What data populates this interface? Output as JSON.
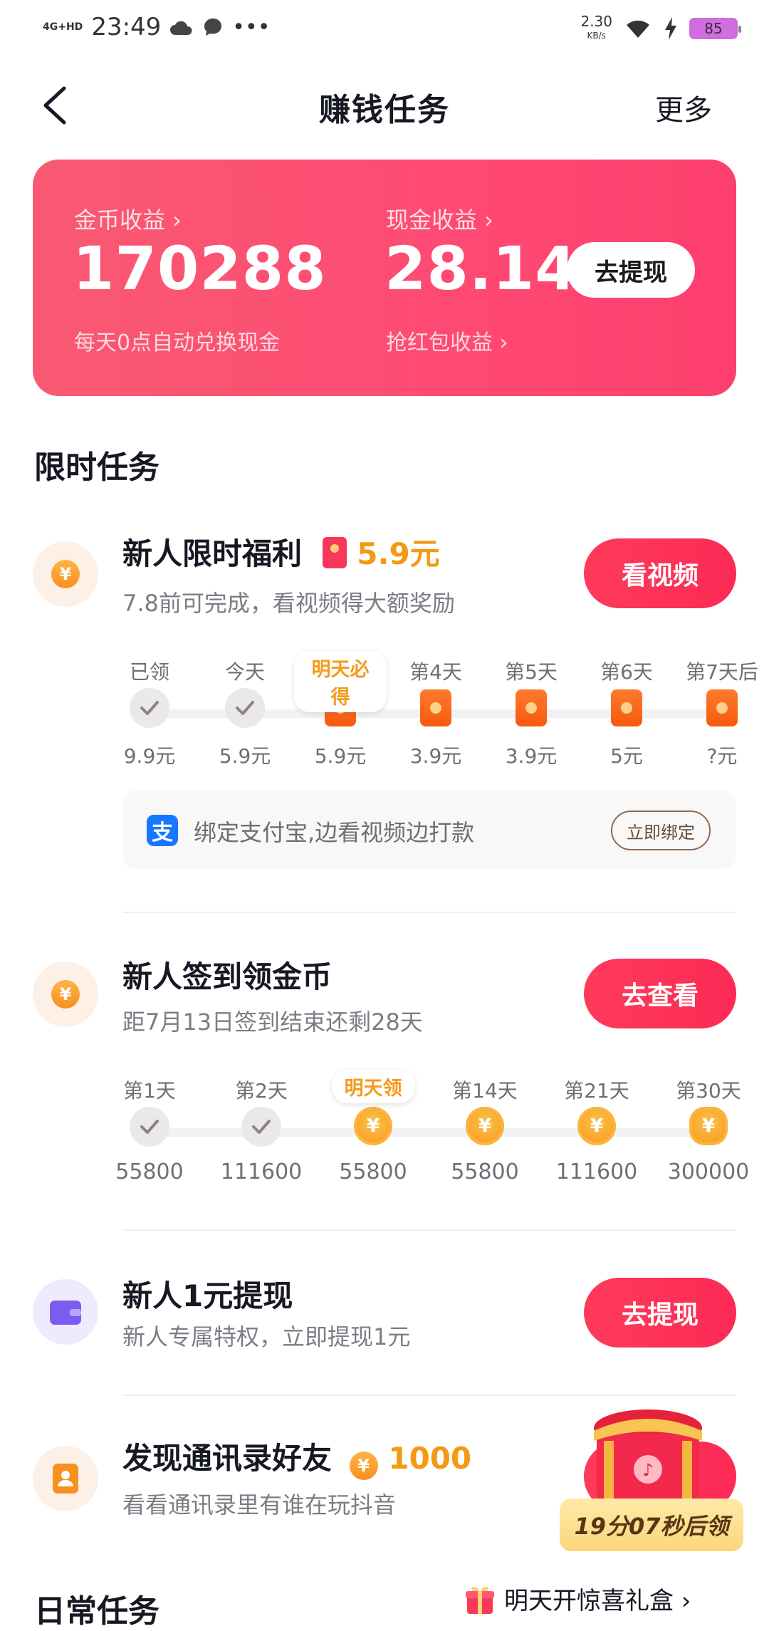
{
  "status_bar": {
    "time": "23:49",
    "network": "4G+HD",
    "speed_value": "2.30",
    "speed_unit": "KB/s",
    "battery": "85"
  },
  "nav": {
    "title": "赚钱任务",
    "more": "更多"
  },
  "earnings": {
    "coin_label": "金币收益 ›",
    "coin_value": "170288",
    "coin_note": "每天0点自动兑换现金",
    "cash_label": "现金收益 ›",
    "cash_value": "28.14",
    "cash_note": "抢红包收益 ›",
    "withdraw": "去提现"
  },
  "limited": {
    "section_title": "限时任务",
    "task1": {
      "title": "新人限时福利",
      "reward": "5.9元",
      "desc": "7.8前可完成，看视频得大额奖励",
      "button": "看视频",
      "steps": [
        {
          "day": "已领",
          "value": "9.9元"
        },
        {
          "day": "今天",
          "value": "5.9元"
        },
        {
          "day": "明天必得",
          "value": "5.9元"
        },
        {
          "day": "第4天",
          "value": "3.9元"
        },
        {
          "day": "第5天",
          "value": "3.9元"
        },
        {
          "day": "第6天",
          "value": "5元"
        },
        {
          "day": "第7天后",
          "value": "?元"
        }
      ],
      "bind_text": "绑定支付宝,边看视频边打款",
      "bind_button": "立即绑定"
    },
    "task2": {
      "title": "新人签到领金币",
      "desc": "距7月13日签到结束还剩28天",
      "button": "去查看",
      "steps": [
        {
          "day": "第1天",
          "value": "55800"
        },
        {
          "day": "第2天",
          "value": "111600"
        },
        {
          "day": "明天领",
          "value": "55800"
        },
        {
          "day": "第14天",
          "value": "55800"
        },
        {
          "day": "第21天",
          "value": "111600"
        },
        {
          "day": "第30天",
          "value": "300000"
        }
      ]
    },
    "task3": {
      "title": "新人1元提现",
      "desc": "新人专属特权，立即提现1元",
      "button": "去提现"
    },
    "task4": {
      "title": "发现通讯录好友",
      "reward": "1000",
      "desc": "看看通讯录里有谁在玩抖音",
      "countdown": "19分07秒后领"
    }
  },
  "daily": {
    "section_title": "日常任务",
    "gift_link": "明天开惊喜礼盒 ›"
  },
  "colors": {
    "accent": "#fe2c55",
    "coin": "#f7901e",
    "card": "#fd4a72"
  }
}
